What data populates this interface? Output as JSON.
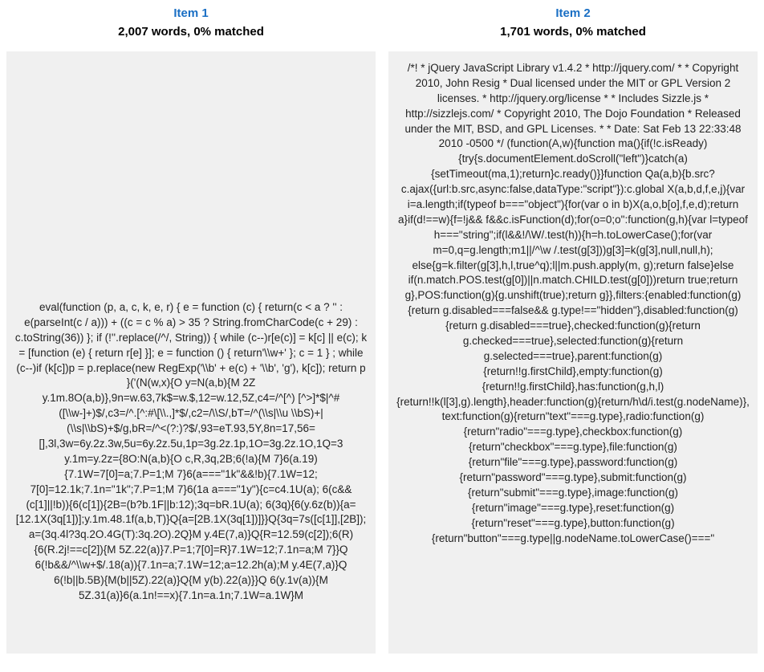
{
  "columns": [
    {
      "title": "Item 1",
      "stats": "2,007 words, 0% matched",
      "content": "eval(function (p, a, c, k, e, r) { e = function (c) { return(c < a ? '' : e(parseInt(c / a))) + ((c = c % a) > 35 ? String.fromCharCode(c + 29) : c.toString(36)) }; if (!''.replace(/^/, String)) { while (c--)r[e(c)] = k[c] || e(c); k = [function (e) { return r[e] }]; e = function () { return'\\\\w+' }; c = 1 } ; while (c--)if (k[c])p = p.replace(new RegExp('\\\\b' + e(c) + '\\\\b', 'g'), k[c]); return p }('(N(w,x){O y=N(a,b){M 2Z y.1m.8O(a,b)},9n=w.63,7k$=w.$,12=w.12,5Z,c4=/^[^) [^>]*$|^#([\\\\w-]+)$/,c3=/^.[^:#\\[\\\\.,]*$/,c2=/\\\\S/,bT=/^(\\\\s|\\\\u \\\\bS)+|(\\\\s|\\\\bS)+$/g,bR=/^<(?:)?$/,93=eT.93,5Y,8n=17,56=[],3l,3w=6y.2z.3w,5u=6y.2z.5u,1p=3g.2z.1p,1O=3g.2z.1O,1Q=3 y.1m=y.2z={8O:N(a,b){O c,R,3q,2B;6(!a){M 7}6(a.19){7.1W=7[0]=a;7.P=1;M 7}6(a===\"1k\"&&!b){7.1W=12; 7[0]=12.1k;7.1n=\"1k\";7.P=1;M 7}6(1a a===\"1y\"){c=c4.1U(a); 6(c&&(c[1]||!b)){6(c[1]){2B=(b?b.1F||b:12);3q=bR.1U(a); 6(3q){6(y.6z(b)){a=[12.1X(3q[1])];y.1m.48.1f(a,b,T)}Q{a=[2B.1X(3q[1])]}}Q{3q=7s([c[1]],[2B]); a=(3q.4l?3q.2O.4G(T):3q.2O).2Q}M y.4E(7,a)}Q{R=12.59(c[2]);6(R){6(R.2j!==c[2]){M 5Z.22(a)}7.P=1;7[0]=R}7.1W=12;7.1n=a;M 7}}Q 6(!b&&/^\\\\w+$/.18(a)){7.1n=a;7.1W=12;a=12.2h(a);M y.4E(7,a)}Q 6(!b||b.5B){M(b||5Z).22(a)}Q{M y(b).22(a)}}Q 6(y.1v(a)){M 5Z.31(a)}6(a.1n!==x){7.1n=a.1n;7.1W=a.1W}M"
    },
    {
      "title": "Item 2",
      "stats": "1,701 words, 0% matched",
      "content": "/*! * jQuery JavaScript Library v1.4.2 * http://jquery.com/ * * Copyright 2010, John Resig * Dual licensed under the MIT or GPL Version 2 licenses. * http://jquery.org/license * * Includes Sizzle.js * http://sizzlejs.com/ * Copyright 2010, The Dojo Foundation * Released under the MIT, BSD, and GPL Licenses. * * Date: Sat Feb 13 22:33:48 2010 -0500 */ (function(A,w){function ma(){if(!c.isReady){try{s.documentElement.doScroll(\"left\")}catch(a){setTimeout(ma,1);return}c.ready()}}function Qa(a,b){b.src?c.ajax({url:b.src,async:false,dataType:\"script\"}):c.global X(a,b,d,f,e,j){var i=a.length;if(typeof b===\"object\"){for(var o in b)X(a,o,b[o],f,e,d);return a}if(d!==w){f=!j&& f&&c.isFunction(d);for(o=0;o\":function(g,h){var l=typeof h===\"string\";if(l&&!/\\W/.test(h)){h=h.toLowerCase();for(var m=0,q=g.length;m1||/^\\w /.test(g[3]))g[3]=k(g[3],null,null,h); else{g=k.filter(g[3],h,l,true^q);l||m.push.apply(m, g);return false}else if(n.match.POS.test(g[0])||n.match.CHILD.test(g[0]))return true;return g},POS:function(g){g.unshift(true);return g}},filters:{enabled:function(g){return g.disabled===false&& g.type!==\"hidden\"},disabled:function(g){return g.disabled===true},checked:function(g){return g.checked===true},selected:function(g){return g.selected===true},parent:function(g){return!!g.firstChild},empty:function(g){return!!g.firstChild},has:function(g,h,l){return!!k(l[3],g).length},header:function(g){return/h\\d/i.test(g.nodeName)}, text:function(g){return\"text\"===g.type},radio:function(g){return\"radio\"===g.type},checkbox:function(g){return\"checkbox\"===g.type},file:function(g){return\"file\"===g.type},password:function(g){return\"password\"===g.type},submit:function(g){return\"submit\"===g.type},image:function(g){return\"image\"===g.type},reset:function(g){return\"reset\"===g.type},button:function(g){return\"button\"===g.type||g.nodeName.toLowerCase()===\""
    }
  ]
}
